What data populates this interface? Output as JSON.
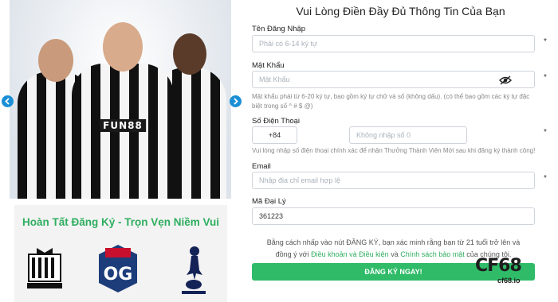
{
  "form": {
    "title": "Vui Lòng Điền Đầy Đủ Thông Tin Của Bạn",
    "username": {
      "label": "Tên Đăng Nhập",
      "placeholder": "Phải có 6-14 ký tự"
    },
    "password": {
      "label": "Mật Khẩu",
      "placeholder": "Mật Khẩu",
      "hint_line1": "Mật khẩu phải từ 6-20 ký tự, bao gồm ký tự chữ và số (không dấu). (có thể bao gồm các ký tự đặc",
      "hint_line2": "biệt trong số ^ # $ @)"
    },
    "phone": {
      "label": "Số Điện Thoại",
      "country_code": "+84",
      "placeholder": "Không nhập số 0",
      "hint": "Vui lòng nhập số điện thoại chính xác để nhận Thưởng Thành Viên Mới sau khi đăng ký thành công!"
    },
    "email": {
      "label": "Email",
      "placeholder": "Nhập địa chỉ email hợp lệ"
    },
    "agent": {
      "label": "Mã Đại Lý",
      "value": "361223"
    },
    "required_mark": "*",
    "terms_line1": "Bằng cách nhấp vào nút ĐĂNG KÝ, bạn xác minh rằng bạn từ 21 tuổi trở lên và",
    "terms_prefix": "đồng ý với",
    "terms_link1": "Điều khoản và Điều kiện",
    "terms_mid": "và",
    "terms_link2": "Chính sách bảo mật",
    "terms_suffix": "của chúng tôi.",
    "submit_label": "ĐĂNG KÝ NGAY!"
  },
  "hero": {
    "sponsor_text": "FUN88",
    "prev_icon": "chevron-left-icon",
    "next_icon": "chevron-right-icon"
  },
  "promo": {
    "title": "Hoàn Tất Đăng Ký - Trọn Vẹn Niềm Vui",
    "logos": [
      "newcastle-united-crest",
      "og-esports-logo",
      "tottenham-hotspur-crest"
    ],
    "logo_og_text": "OG"
  },
  "brand": {
    "main": "CF68",
    "sub": "cf68.io"
  },
  "colors": {
    "accent": "#2fbb68",
    "arrow": "#1b8fd6",
    "title_green": "#2fae60"
  }
}
